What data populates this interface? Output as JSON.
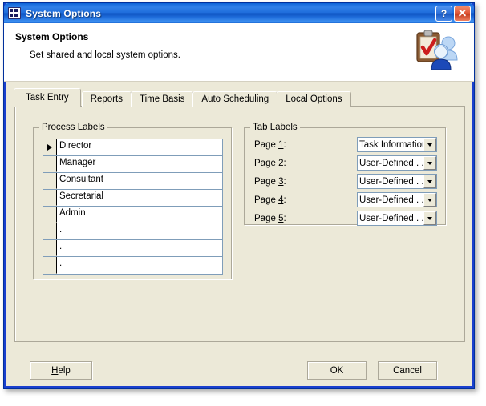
{
  "window": {
    "title": "System Options",
    "icon": "table-grid-icon",
    "titlebar_buttons": [
      {
        "name": "help",
        "label": "?"
      },
      {
        "name": "close",
        "label": "X"
      }
    ]
  },
  "header": {
    "title": "System Options",
    "subtitle": "Set shared and local system options.",
    "icon": "clipboard-users-icon"
  },
  "tabs": [
    {
      "label": "Task Entry",
      "selected": true
    },
    {
      "label": "Reports",
      "selected": false
    },
    {
      "label": "Time Basis",
      "selected": false
    },
    {
      "label": "Auto Scheduling",
      "selected": false
    },
    {
      "label": "Local Options",
      "selected": false
    }
  ],
  "process_labels": {
    "group_title": "Process Labels",
    "selected_row": 0,
    "rows": [
      {
        "value": "Director"
      },
      {
        "value": "Manager"
      },
      {
        "value": "Consultant"
      },
      {
        "value": "Secretarial"
      },
      {
        "value": "Admin"
      },
      {
        "value": "."
      },
      {
        "value": "."
      },
      {
        "value": "."
      }
    ]
  },
  "tab_labels": {
    "group_title": "Tab Labels",
    "rows": [
      {
        "label_prefix": "Page ",
        "accesskey": "1",
        "label_suffix": ":",
        "value": "Task Information"
      },
      {
        "label_prefix": "Page ",
        "accesskey": "2",
        "label_suffix": ":",
        "value": "User-Defined . . :"
      },
      {
        "label_prefix": "Page ",
        "accesskey": "3",
        "label_suffix": ":",
        "value": "User-Defined  . ."
      },
      {
        "label_prefix": "Page ",
        "accesskey": "4",
        "label_suffix": ":",
        "value": "User-Defined  . ."
      },
      {
        "label_prefix": "Page ",
        "accesskey": "5",
        "label_suffix": ":",
        "value": "User-Defined  . ."
      }
    ]
  },
  "buttons": {
    "help_prefix": "",
    "help_accesskey": "H",
    "help_suffix": "elp",
    "ok": "OK",
    "cancel": "Cancel"
  },
  "colors": {
    "dialog_bg": "#ece9d8",
    "titlebar_blue": "#1f6ddb",
    "frame_blue": "#1a3fce",
    "control_border": "#7f9db9",
    "group_border": "#aca899"
  }
}
